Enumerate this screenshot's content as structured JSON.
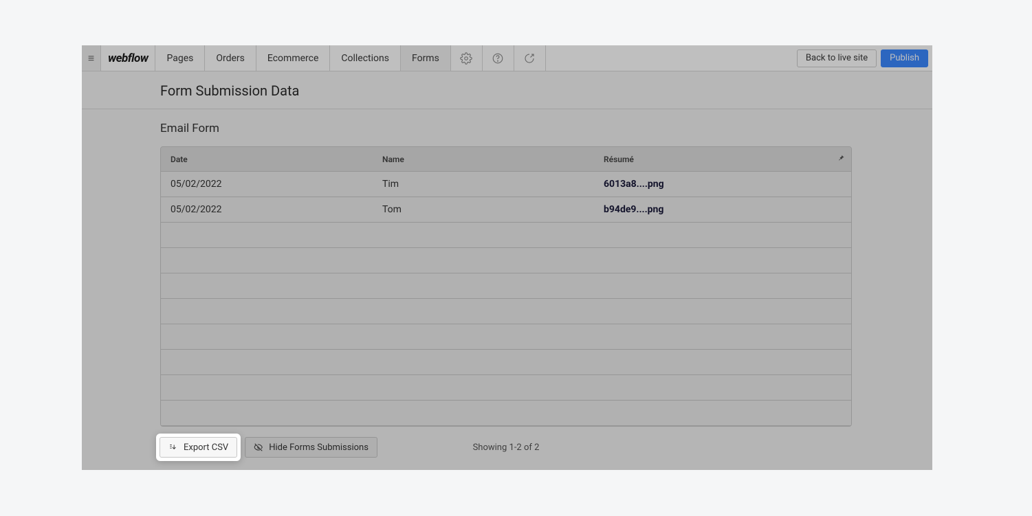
{
  "logo": "webflow",
  "tabs": [
    {
      "label": "Pages"
    },
    {
      "label": "Orders"
    },
    {
      "label": "Ecommerce"
    },
    {
      "label": "Collections"
    },
    {
      "label": "Forms"
    }
  ],
  "active_tab_index": 4,
  "header": {
    "back_to_live": "Back to live site",
    "publish": "Publish"
  },
  "page": {
    "title": "Form Submission Data",
    "form_title": "Email Form"
  },
  "table": {
    "columns": {
      "date": "Date",
      "name": "Name",
      "resume": "Résumé"
    },
    "rows": [
      {
        "date": "05/02/2022",
        "name": "Tim",
        "resume": "6013a8....png"
      },
      {
        "date": "05/02/2022",
        "name": "Tom",
        "resume": "b94de9....png"
      }
    ],
    "empty_row_count": 8
  },
  "actions": {
    "export_csv": "Export CSV",
    "hide_forms": "Hide Forms Submissions"
  },
  "pagination": "Showing 1-2 of 2"
}
